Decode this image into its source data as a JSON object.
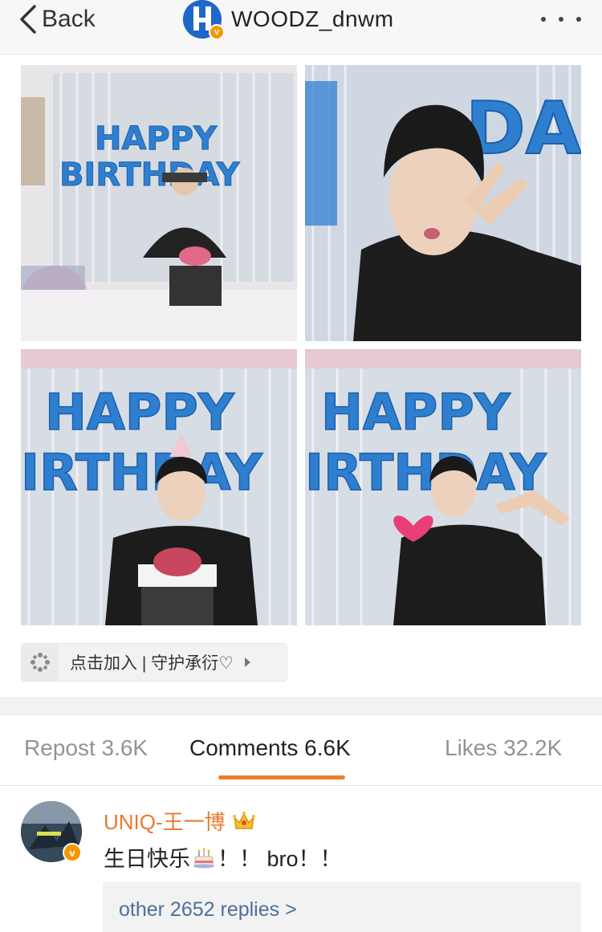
{
  "nav": {
    "back_label": "Back",
    "title": "WOODZ_dnwm",
    "verified_badge": "v",
    "more_icon": "more-dots-icon"
  },
  "photos": [
    {
      "id": "photo-1",
      "balloon_text": "HAPPY BIRTHDAY"
    },
    {
      "id": "photo-2",
      "balloon_text": "DA"
    },
    {
      "id": "photo-3",
      "balloon_text": "HAPPY BIRTHDAY"
    },
    {
      "id": "photo-4",
      "balloon_text": "HAPPY BIRTHDAY"
    }
  ],
  "super_topic": {
    "label": "点击加入 | 守护承衍♡",
    "icon": "sparkle-topic-icon"
  },
  "tabs": [
    {
      "label": "Repost 3.6K",
      "active": false
    },
    {
      "label": "Comments 6.6K",
      "active": true
    },
    {
      "label": "Likes 32.2K",
      "active": false
    }
  ],
  "comment": {
    "username": "UNIQ-王一博",
    "verified_badge": "v",
    "text_before": "生日快乐",
    "text_after": "！！ bro！！",
    "replies_label": "other 2652 replies >"
  },
  "colors": {
    "accent": "#f07c2a",
    "username": "#eb7a2e",
    "link": "#4e6e9a",
    "balloon": "#2f7fd1",
    "verified": "#f39800"
  }
}
